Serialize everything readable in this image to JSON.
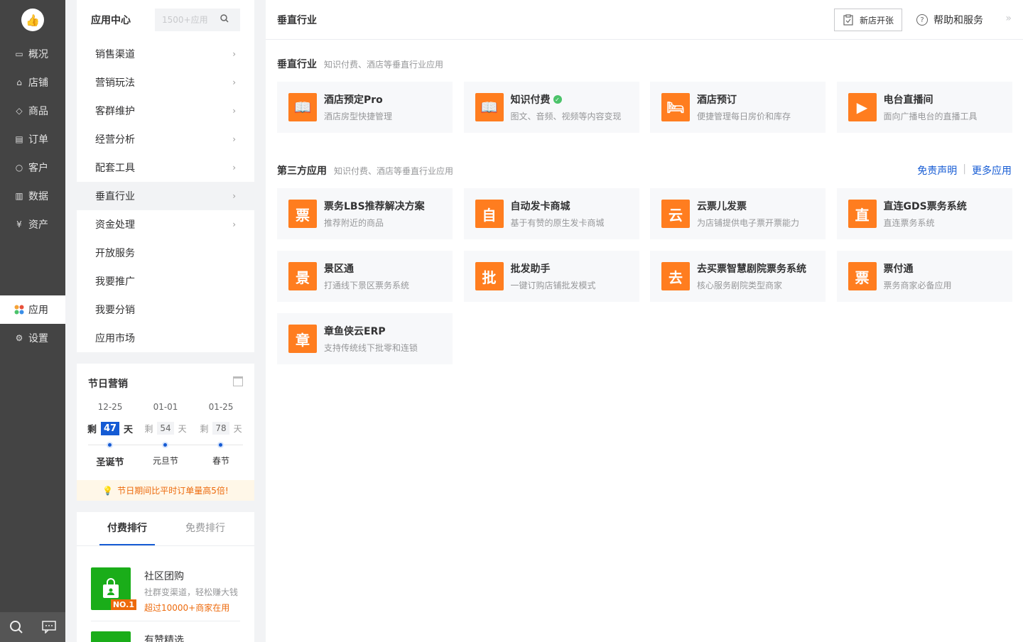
{
  "nav": {
    "items": [
      {
        "label": "概况",
        "icon": "monitor-icon"
      },
      {
        "label": "店铺",
        "icon": "store-icon"
      },
      {
        "label": "商品",
        "icon": "tag-icon"
      },
      {
        "label": "订单",
        "icon": "order-icon"
      },
      {
        "label": "客户",
        "icon": "user-icon"
      },
      {
        "label": "数据",
        "icon": "chart-icon"
      },
      {
        "label": "资产",
        "icon": "yuan-icon"
      },
      {
        "label": "应用",
        "icon": "apps-icon"
      },
      {
        "label": "设置",
        "icon": "gear-icon"
      }
    ]
  },
  "sidebar": {
    "title": "应用中心",
    "search_placeholder": "1500+应用",
    "menu": [
      {
        "label": "销售渠道",
        "arrow": true
      },
      {
        "label": "营销玩法",
        "arrow": true
      },
      {
        "label": "客群维护",
        "arrow": true
      },
      {
        "label": "经营分析",
        "arrow": true
      },
      {
        "label": "配套工具",
        "arrow": true
      },
      {
        "label": "垂直行业",
        "arrow": true
      },
      {
        "label": "资金处理",
        "arrow": true
      },
      {
        "label": "开放服务",
        "arrow": false
      },
      {
        "label": "我要推广",
        "arrow": false
      },
      {
        "label": "我要分销",
        "arrow": false
      },
      {
        "label": "应用市场",
        "arrow": false
      }
    ],
    "arrow_glyph": "›"
  },
  "holiday": {
    "title": "节日营销",
    "remain_prefix": "剩",
    "remain_suffix": "天",
    "items": [
      {
        "date": "12-25",
        "days": "47",
        "name": "圣诞节"
      },
      {
        "date": "01-01",
        "days": "54",
        "name": "元旦节"
      },
      {
        "date": "01-25",
        "days": "78",
        "name": "春节"
      }
    ],
    "tip": "节日期间比平时订单量高5倍!"
  },
  "ranking": {
    "tabs": [
      "付费排行",
      "免费排行"
    ],
    "items": [
      {
        "name": "社区团购",
        "desc": "社群变渠道，轻松赚大钱",
        "hot": "超过10000+商家在用",
        "badge": "NO.1"
      },
      {
        "name": "有赞精选",
        "desc": "",
        "hot": "",
        "badge": ""
      }
    ]
  },
  "main": {
    "title": "垂直行业",
    "new_store_label": "新店开张",
    "help_label": "帮助和服务",
    "collapse_glyph": "»",
    "sections": [
      {
        "title": "垂直行业",
        "subtitle": "知识付费、酒店等垂直行业应用",
        "cards": [
          {
            "name": "酒店预定Pro",
            "desc": "酒店房型快捷管理",
            "glyph": "📖",
            "verified": false
          },
          {
            "name": "知识付费",
            "desc": "图文、音频、视频等内容变现",
            "glyph": "📖",
            "verified": true
          },
          {
            "name": "酒店预订",
            "desc": "便捷管理每日房价和库存",
            "glyph": "🛏",
            "verified": false
          },
          {
            "name": "电台直播间",
            "desc": "面向广播电台的直播工具",
            "glyph": "▶",
            "verified": false
          }
        ]
      },
      {
        "title": "第三方应用",
        "subtitle": "知识付费、酒店等垂直行业应用",
        "links": [
          "免责声明",
          "更多应用"
        ],
        "cards": [
          {
            "name": "票务LBS推荐解决方案",
            "desc": "推荐附近的商品",
            "glyph": "票"
          },
          {
            "name": "自动发卡商城",
            "desc": "基于有赞的原生发卡商城",
            "glyph": "自"
          },
          {
            "name": "云票儿发票",
            "desc": "为店铺提供电子票开票能力",
            "glyph": "云"
          },
          {
            "name": "直连GDS票务系统",
            "desc": "直连票务系统",
            "glyph": "直"
          },
          {
            "name": "景区通",
            "desc": "打通线下景区票务系统",
            "glyph": "景"
          },
          {
            "name": "批发助手",
            "desc": "一键订购店铺批发模式",
            "glyph": "批"
          },
          {
            "name": "去买票智慧剧院票务系统",
            "desc": "核心服务剧院类型商家",
            "glyph": "去"
          },
          {
            "name": "票付通",
            "desc": "票务商家必备应用",
            "glyph": "票"
          },
          {
            "name": "章鱼侠云ERP",
            "desc": "支持传统线下批零和连锁",
            "glyph": "章"
          }
        ]
      }
    ]
  },
  "colors": {
    "accent": "#155bd4",
    "orange": "#ff7d1f",
    "nav_bg": "#444444",
    "green": "#1aad19"
  }
}
